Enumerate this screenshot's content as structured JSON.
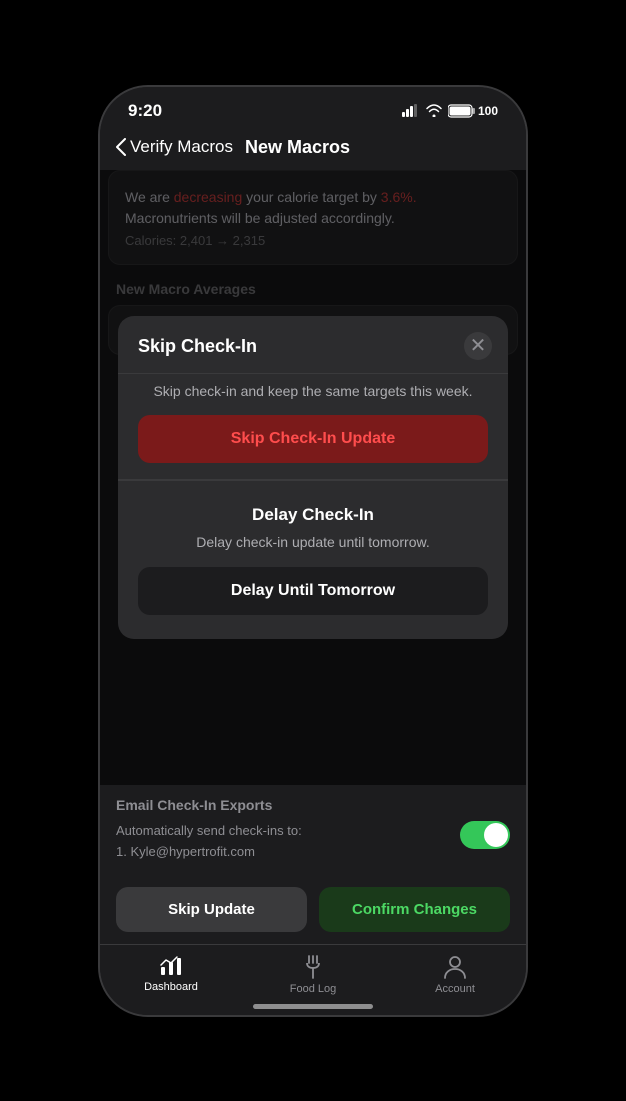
{
  "statusBar": {
    "time": "9:20",
    "batteryLevel": "100"
  },
  "navHeader": {
    "backLabel": "Verify Macros",
    "title": "New Macros"
  },
  "infoCard": {
    "mainTextPart1": "We are ",
    "mainTextHighlight": "decreasing",
    "mainTextPart2": " your calorie target by ",
    "mainTextPercent": "3.6%.",
    "mainTextEnd": "",
    "subText": "Macronutrients will be adjusted accordingly.",
    "caloriesLabel": "Calories: 2,401",
    "caloriesArrow": "→",
    "caloriesNew": "2,315"
  },
  "macroSection": {
    "title": "New Macro Averages"
  },
  "modal": {
    "title": "Skip Check-In",
    "closeLabel": "✕",
    "skipDesc": "Skip check-in and keep the same targets this week.",
    "skipBtnLabel": "Skip Check-In Update",
    "delayTitle": "Delay Check-In",
    "delayDesc": "Delay check-in update until tomorrow.",
    "delayBtnLabel": "Delay Until Tomorrow"
  },
  "emailSection": {
    "title": "Email Check-In Exports",
    "subText": "Automatically send check-ins to:\n1. Kyle@hypertrofit.com",
    "toggleOn": true
  },
  "actionButtons": {
    "skipLabel": "Skip Update",
    "confirmLabel": "Confirm Changes"
  },
  "tabBar": {
    "items": [
      {
        "id": "dashboard",
        "label": "Dashboard",
        "active": true,
        "icon": "chart"
      },
      {
        "id": "foodlog",
        "label": "Food Log",
        "active": false,
        "icon": "fork"
      },
      {
        "id": "account",
        "label": "Account",
        "active": false,
        "icon": "person"
      }
    ]
  }
}
